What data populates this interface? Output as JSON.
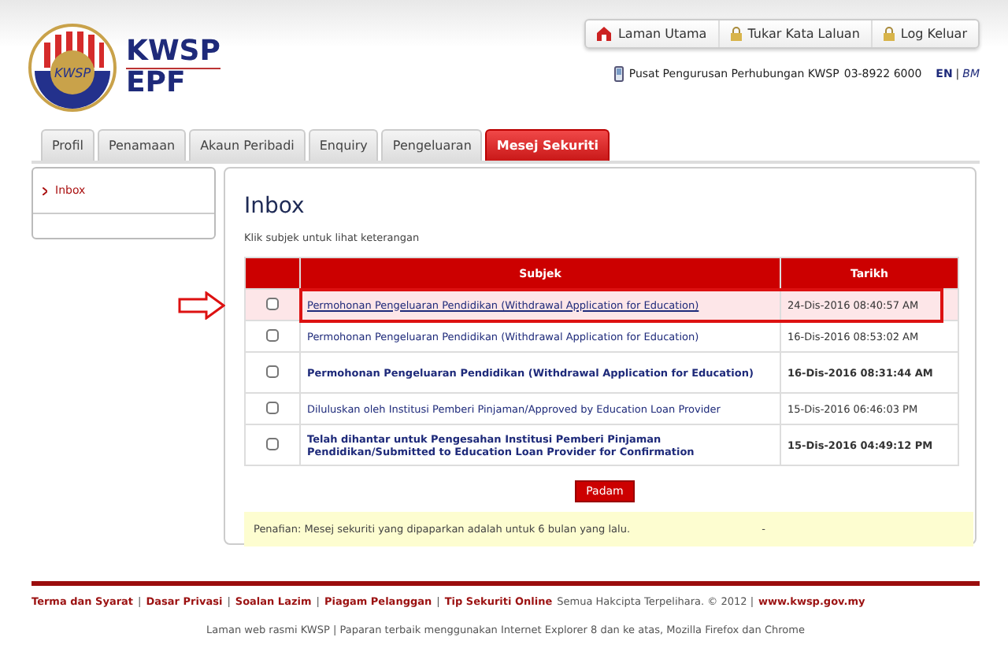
{
  "brand": {
    "seal_text": "KWSP",
    "name": "KWSP",
    "subname": "EPF"
  },
  "top_links": [
    {
      "label": "Laman Utama",
      "kind": "home"
    },
    {
      "label": "Tukar Kata Laluan",
      "kind": "password"
    },
    {
      "label": "Log Keluar",
      "kind": "logout"
    }
  ],
  "contact": {
    "label": "Pusat Pengurusan Perhubungan KWSP",
    "phone": "03-8922 6000"
  },
  "languages": [
    {
      "label": "EN",
      "selected": true
    },
    {
      "label": "|",
      "kind": "sep"
    },
    {
      "label": "BM",
      "selected": false
    }
  ],
  "tabs": [
    {
      "label": "Profil",
      "selected": false
    },
    {
      "label": "Penamaan",
      "selected": false
    },
    {
      "label": "Akaun Peribadi",
      "selected": false
    },
    {
      "label": "Enquiry",
      "selected": false
    },
    {
      "label": "Pengeluaran",
      "selected": false
    },
    {
      "label": "Mesej Sekuriti",
      "selected": true
    }
  ],
  "sidebar": {
    "items": [
      {
        "label": "Inbox",
        "selected": true
      }
    ]
  },
  "inbox": {
    "title": "Inbox",
    "hint": "Klik subjek untuk lihat keterangan",
    "columns": [
      "Subjek",
      "Tarikh"
    ],
    "rows": [
      {
        "checked": false,
        "selected": true,
        "unread": false,
        "subject": "Permohonan Pengeluaran Pendidikan (Withdrawal Application for Education)",
        "date": "24-Dis-2016 08:40:57 AM"
      },
      {
        "checked": false,
        "selected": false,
        "unread": false,
        "subject": "Permohonan Pengeluaran Pendidikan (Withdrawal Application for Education)",
        "date": "16-Dis-2016 08:53:02 AM"
      },
      {
        "checked": false,
        "selected": false,
        "unread": true,
        "subject": "Permohonan Pengeluaran Pendidikan (Withdrawal Application for Education)",
        "date": "16-Dis-2016 08:31:44 AM"
      },
      {
        "checked": false,
        "selected": false,
        "unread": false,
        "subject": "Diluluskan oleh Institusi Pemberi Pinjaman/Approved by Education Loan Provider",
        "date": "15-Dis-2016 06:46:03 PM"
      },
      {
        "checked": false,
        "selected": false,
        "unread": true,
        "subject": "Telah dihantar untuk Pengesahan Institusi Pemberi Pinjaman Pendidikan/Submitted to Education Loan Provider for Confirmation",
        "date": "15-Dis-2016 04:49:12 PM"
      }
    ],
    "delete_button": "Padam",
    "disclaimer": "Penafian: Mesej sekuriti yang dipaparkan adalah untuk 6 bulan yang lalu.",
    "disclaimer_mark": "-"
  },
  "footer": {
    "items": [
      {
        "kind": "link",
        "text": "Terma dan Syarat"
      },
      {
        "kind": "text",
        "text": "|"
      },
      {
        "kind": "link",
        "text": "Dasar Privasi"
      },
      {
        "kind": "text",
        "text": "|"
      },
      {
        "kind": "link",
        "text": "Soalan Lazim"
      },
      {
        "kind": "text",
        "text": "|"
      },
      {
        "kind": "link",
        "text": "Piagam Pelanggan"
      },
      {
        "kind": "text",
        "text": "|"
      },
      {
        "kind": "link",
        "text": "Tip Sekuriti Online"
      },
      {
        "kind": "text",
        "text": "Semua Hakcipta Terpelihara. © 2012 |"
      },
      {
        "kind": "link",
        "text": "www.kwsp.gov.my"
      }
    ],
    "note": "Laman web rasmi KWSP | Paparan terbaik menggunakan Internet Explorer 8 dan ke atas, Mozilla Firefox dan Chrome"
  }
}
